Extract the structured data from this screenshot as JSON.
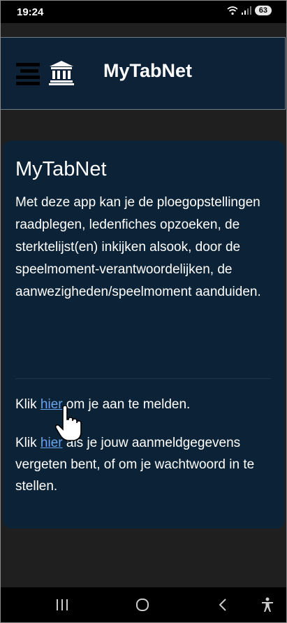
{
  "status": {
    "time": "19:24",
    "battery": "63"
  },
  "appbar": {
    "title": "MyTabNet"
  },
  "card": {
    "title": "MyTabNet",
    "description": "Met deze app kan je de ploegopstellingen raadplegen, ledenfiches opzoeken, de sterktelijst(en) inkijken alsook, door de speelmoment-verantwoordelijken, de aanwezigheden/speelmoment aanduiden.",
    "login": {
      "prefix": "Klik ",
      "link": "hier",
      "suffix": " om je aan te melden."
    },
    "reset": {
      "prefix": "Klik ",
      "link": "hier",
      "suffix": " als je jouw aanmeldgegevens vergeten bent, of om je wachtwoord in te stellen."
    }
  },
  "colors": {
    "background": "#1f1f1f",
    "card": "#0c2236",
    "appbar": "#0d2236",
    "link": "#6aa6ec"
  }
}
